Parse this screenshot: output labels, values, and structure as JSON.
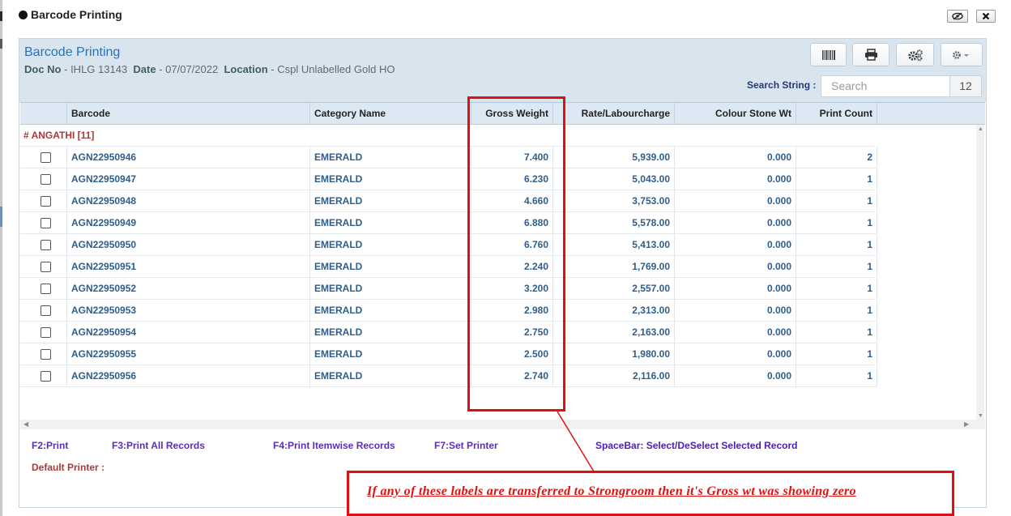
{
  "window": {
    "title": "Barcode Printing"
  },
  "header": {
    "title": "Barcode Printing",
    "doc_no_label": "Doc No",
    "doc_no_value": "- IHLG 13143",
    "date_label": "Date",
    "date_value": "- 07/07/2022",
    "location_label": "Location",
    "location_value": "- Cspl Unlabelled Gold HO"
  },
  "search": {
    "label": "Search String :",
    "placeholder": "Search",
    "count": "12"
  },
  "icons": {
    "barcode": "barcode-icon",
    "print": "printer-icon",
    "gears": "gears-icon",
    "settings": "settings-dropdown-icon",
    "eye": "eye-slash-icon",
    "close": "close-icon"
  },
  "grid": {
    "columns": [
      "Barcode",
      "Category Name",
      "Gross Weight",
      "Rate/Labourcharge",
      "Colour Stone Wt",
      "Print Count"
    ],
    "group": "# ANGATHI [11]",
    "rows": [
      {
        "barcode": "AGN22950946",
        "category": "EMERALD",
        "gross_weight": "7.400",
        "rate": "5,939.00",
        "stone_wt": "0.000",
        "print_count": "2"
      },
      {
        "barcode": "AGN22950947",
        "category": "EMERALD",
        "gross_weight": "6.230",
        "rate": "5,043.00",
        "stone_wt": "0.000",
        "print_count": "1"
      },
      {
        "barcode": "AGN22950948",
        "category": "EMERALD",
        "gross_weight": "4.660",
        "rate": "3,753.00",
        "stone_wt": "0.000",
        "print_count": "1"
      },
      {
        "barcode": "AGN22950949",
        "category": "EMERALD",
        "gross_weight": "6.880",
        "rate": "5,578.00",
        "stone_wt": "0.000",
        "print_count": "1"
      },
      {
        "barcode": "AGN22950950",
        "category": "EMERALD",
        "gross_weight": "6.760",
        "rate": "5,413.00",
        "stone_wt": "0.000",
        "print_count": "1"
      },
      {
        "barcode": "AGN22950951",
        "category": "EMERALD",
        "gross_weight": "2.240",
        "rate": "1,769.00",
        "stone_wt": "0.000",
        "print_count": "1"
      },
      {
        "barcode": "AGN22950952",
        "category": "EMERALD",
        "gross_weight": "3.200",
        "rate": "2,557.00",
        "stone_wt": "0.000",
        "print_count": "1"
      },
      {
        "barcode": "AGN22950953",
        "category": "EMERALD",
        "gross_weight": "2.980",
        "rate": "2,313.00",
        "stone_wt": "0.000",
        "print_count": "1"
      },
      {
        "barcode": "AGN22950954",
        "category": "EMERALD",
        "gross_weight": "2.750",
        "rate": "2,163.00",
        "stone_wt": "0.000",
        "print_count": "1"
      },
      {
        "barcode": "AGN22950955",
        "category": "EMERALD",
        "gross_weight": "2.500",
        "rate": "1,980.00",
        "stone_wt": "0.000",
        "print_count": "1"
      },
      {
        "barcode": "AGN22950956",
        "category": "EMERALD",
        "gross_weight": "2.740",
        "rate": "2,116.00",
        "stone_wt": "0.000",
        "print_count": "1"
      }
    ]
  },
  "footer": {
    "f2": "F2:Print",
    "f3": "F3:Print All Records",
    "f4": "F4:Print Itemwise Records",
    "f7": "F7:Set Printer",
    "space": "SpaceBar: Select/DeSelect Selected Record",
    "default_printer": "Default Printer :"
  },
  "annotation": {
    "note": "If any of these labels are transferred to Strongroom then it's Gross wt was showing zero",
    "color": "#e01010"
  }
}
